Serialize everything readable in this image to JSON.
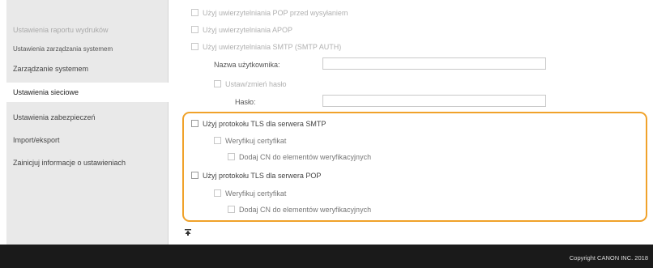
{
  "sidebar": {
    "items": [
      {
        "label": "Ustawienia raportu wydruków"
      },
      {
        "label": "Ustawienia zarządzania systemem"
      },
      {
        "label": "Zarządzanie systemem"
      },
      {
        "label": "Ustawienia sieciowe"
      },
      {
        "label": "Ustawienia zabezpieczeń"
      },
      {
        "label": "Import/eksport"
      },
      {
        "label": "Zainicjuj informacje o ustawieniach"
      }
    ]
  },
  "form": {
    "pop_before_send": "Użyj uwierzytelniania POP przed wysyłaniem",
    "apop": "Użyj uwierzytelniania APOP",
    "smtp_auth": "Użyj uwierzytelniania SMTP (SMTP AUTH)",
    "username_label": "Nazwa użytkownika:",
    "set_password": "Ustaw/zmień hasło",
    "password_label": "Hasło:",
    "tls_smtp": "Użyj protokołu TLS dla serwera SMTP",
    "verify_cert_smtp": "Weryfikuj certyfikat",
    "add_cn_smtp": "Dodaj CN do elementów weryfikacyjnych",
    "tls_pop": "Użyj protokołu TLS dla serwera POP",
    "verify_cert_pop": "Weryfikuj certyfikat",
    "add_cn_pop": "Dodaj CN do elementów weryfikacyjnych"
  },
  "highlight_color": "#f0a22a",
  "scroll_top_icon": "arrow-to-top-icon",
  "footer": {
    "copyright": "Copyright CANON INC. 2018"
  }
}
